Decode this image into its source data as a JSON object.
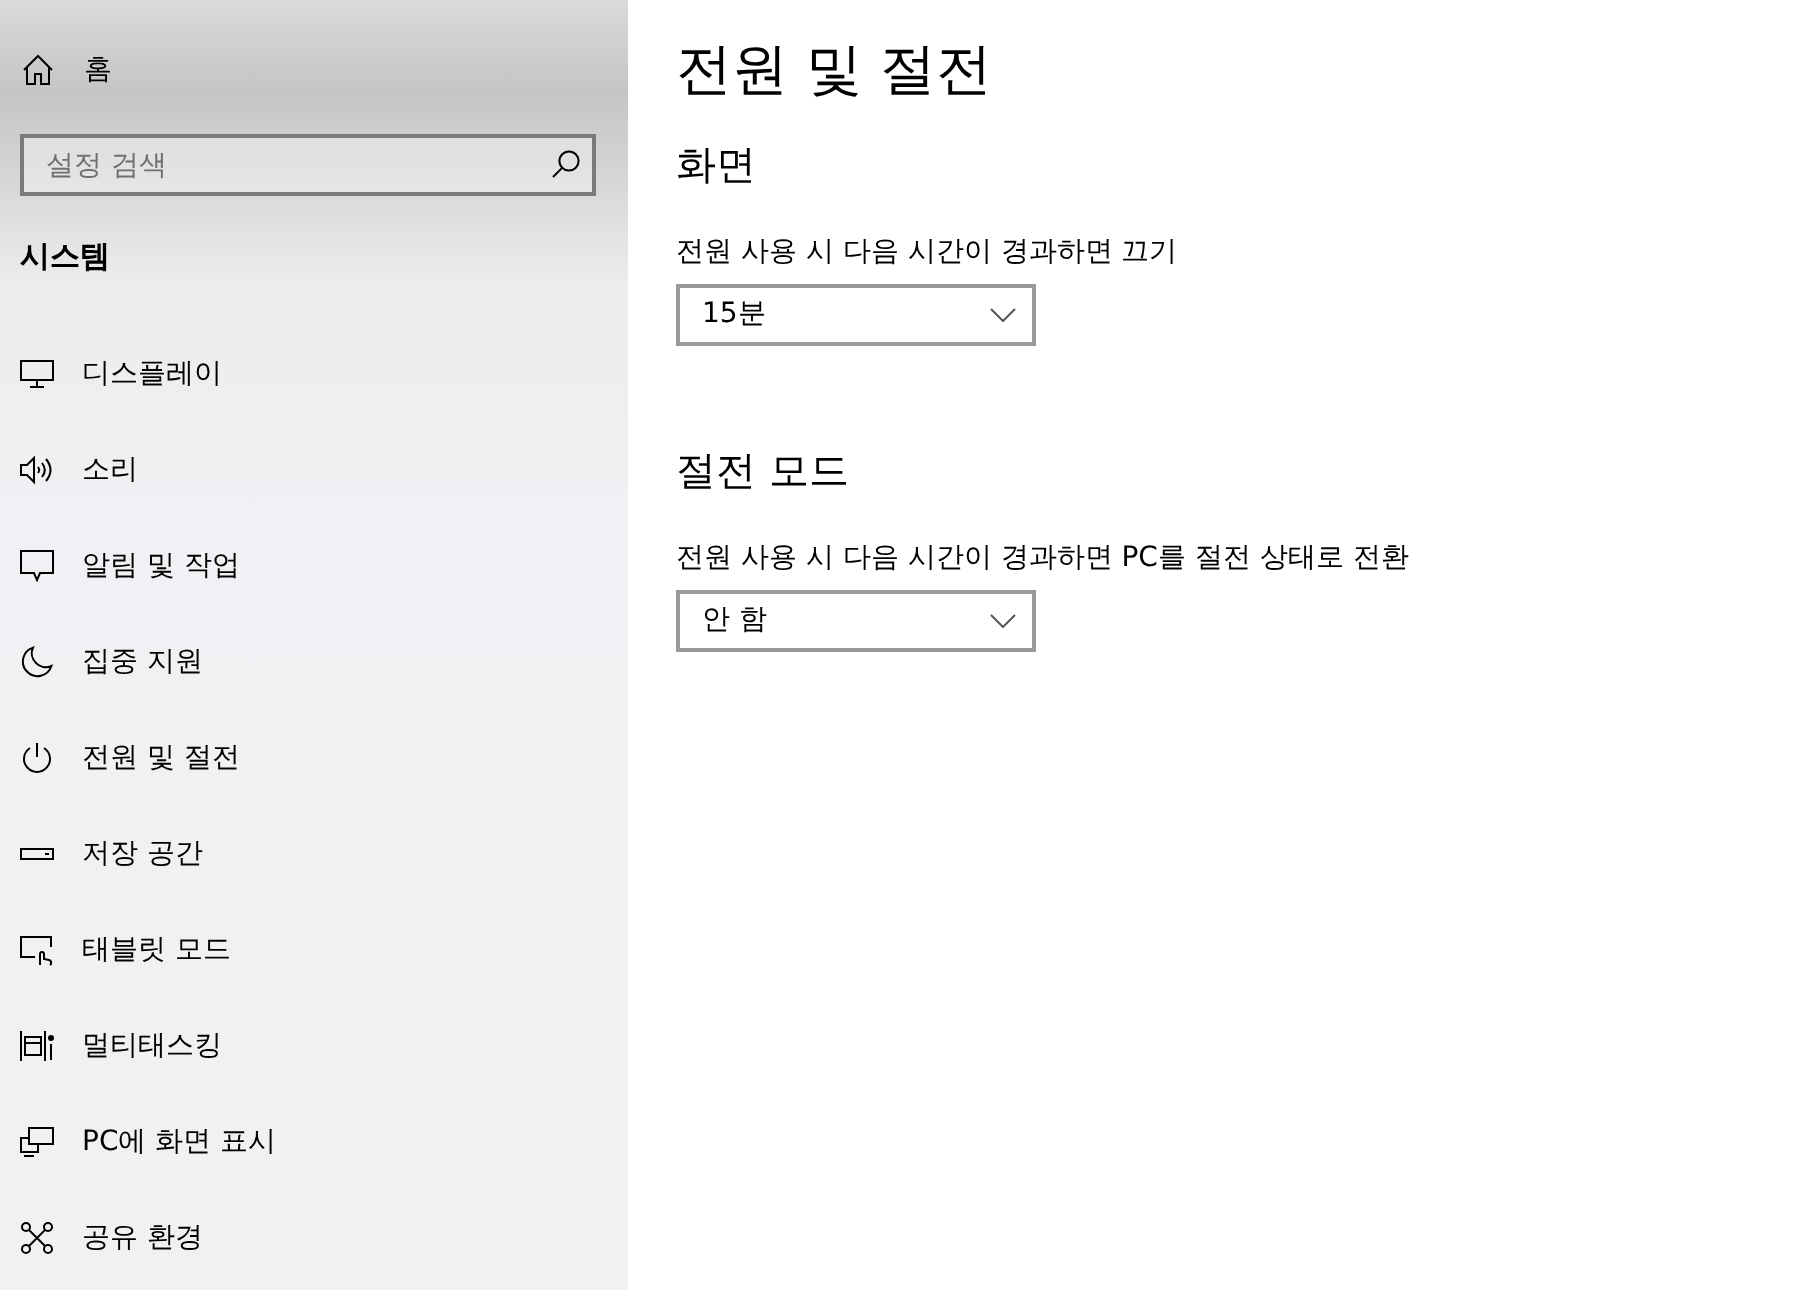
{
  "sidebar": {
    "home": {
      "label": "홈"
    },
    "search": {
      "placeholder": "설정 검색"
    },
    "section_title": "시스템",
    "items": [
      {
        "kind": "display",
        "label": "디스플레이"
      },
      {
        "kind": "sound",
        "label": "소리"
      },
      {
        "kind": "notifications",
        "label": "알림 및 작업"
      },
      {
        "kind": "focus",
        "label": "집중 지원"
      },
      {
        "kind": "power",
        "label": "전원 및 절전"
      },
      {
        "kind": "storage",
        "label": "저장 공간"
      },
      {
        "kind": "tablet",
        "label": "태블릿 모드"
      },
      {
        "kind": "multitasking",
        "label": "멀티태스킹"
      },
      {
        "kind": "projecting",
        "label": "PC에 화면 표시"
      },
      {
        "kind": "shared",
        "label": "공유 환경"
      }
    ]
  },
  "main": {
    "title": "전원 및 절전",
    "sections": [
      {
        "heading": "화면",
        "settings": [
          {
            "label": "전원 사용 시 다음 시간이 경과하면 끄기",
            "value": "15분"
          }
        ]
      },
      {
        "heading": "절전 모드",
        "settings": [
          {
            "label": "전원 사용 시 다음 시간이 경과하면 PC를 절전 상태로 전환",
            "value": "안 함"
          }
        ]
      }
    ]
  }
}
